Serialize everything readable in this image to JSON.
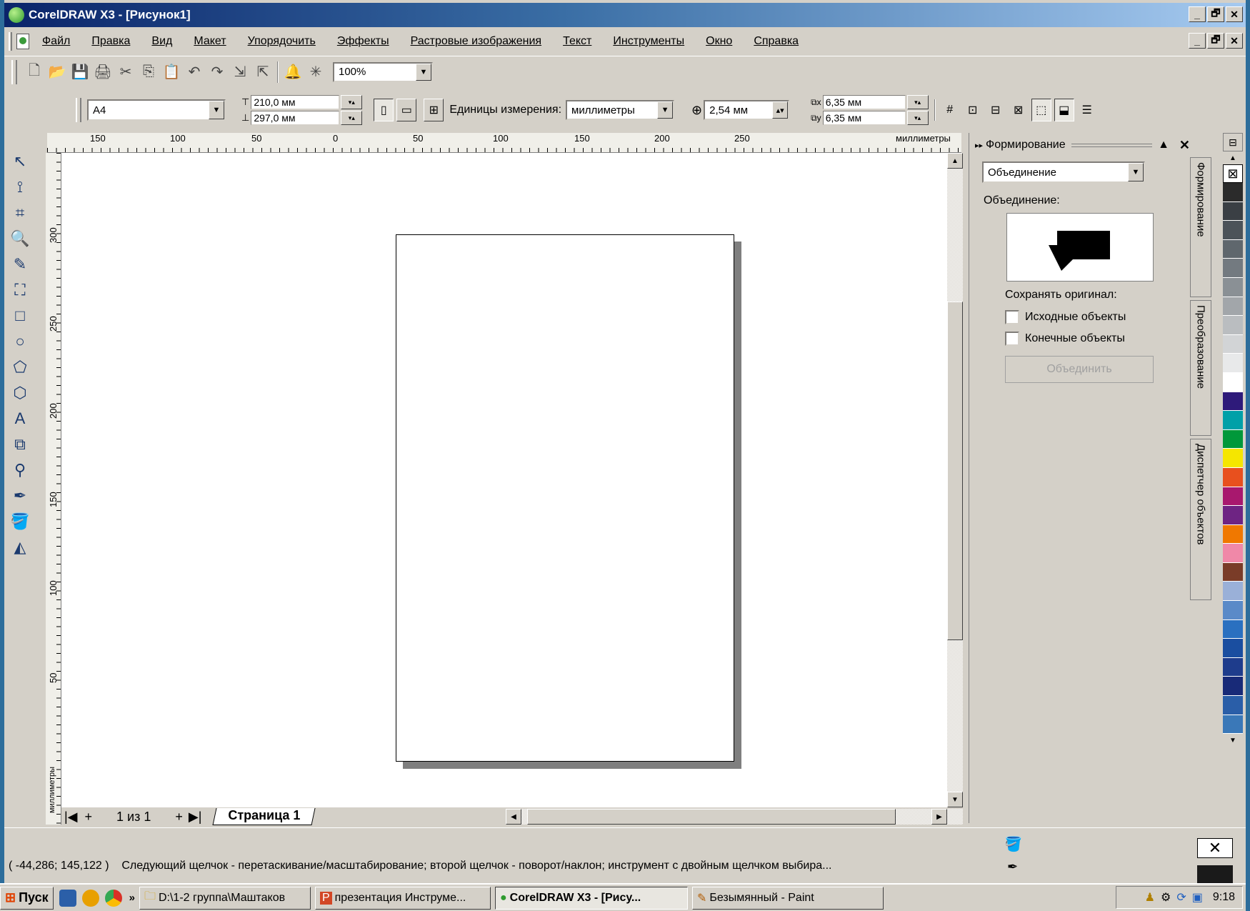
{
  "window": {
    "title": "CorelDRAW X3 - [Рисунок1]",
    "minimize": "_",
    "maximize": "🗗",
    "close": "✕"
  },
  "menu": [
    "Файл",
    "Правка",
    "Вид",
    "Макет",
    "Упорядочить",
    "Эффекты",
    "Растровые изображения",
    "Текст",
    "Инструменты",
    "Окно",
    "Справка"
  ],
  "toolbar": {
    "zoom": "100%"
  },
  "property_bar": {
    "paper": "A4",
    "width": "210,0 мм",
    "height": "297,0 мм",
    "units_label": "Единицы измерения:",
    "units": "миллиметры",
    "nudge": "2,54 мм",
    "dup_x": "6,35 мм",
    "dup_y": "6,35 мм"
  },
  "ruler": {
    "top_labels": [
      "150",
      "100",
      "50",
      "0",
      "50",
      "100",
      "150",
      "200",
      "250"
    ],
    "unit": "миллиметры",
    "left_labels": [
      "300",
      "250",
      "200",
      "150",
      "100",
      "50"
    ],
    "left_unit": "миллиметры"
  },
  "page_nav": {
    "count": "1 из 1",
    "tab": "Страница 1"
  },
  "docker": {
    "title": "Формирование",
    "mode": "Объединение",
    "section": "Объединение:",
    "keep_label": "Сохранять оригинал:",
    "opt1": "Исходные объекты",
    "opt2": "Конечные объекты",
    "apply": "Объединить",
    "tabs": [
      "Формирование",
      "Преобразование",
      "Диспетчер объектов"
    ]
  },
  "palette": [
    "#2b2b2b",
    "#3a3f44",
    "#4c5359",
    "#5f676d",
    "#737a80",
    "#8a9095",
    "#a2a6aa",
    "#babdc0",
    "#d2d4d6",
    "#e8e9ea",
    "#ffffff",
    "#2e1a7a",
    "#00a0a8",
    "#00983a",
    "#f5e600",
    "#e8501e",
    "#a8186e",
    "#6e2483",
    "#f07800",
    "#f088a8",
    "#7a3c28",
    "#9ab0d8",
    "#5a8ac8",
    "#2a70c0",
    "#1a4ea0",
    "#1e3c8c",
    "#182a78",
    "#2a5ea8",
    "#3a78b8"
  ],
  "status": {
    "coords": "( -44,286; 145,122 )",
    "message": "Следующий щелчок - перетаскивание/масштабирование; второй щелчок - поворот/наклон; инструмент с двойным щелчком выбира..."
  },
  "taskbar": {
    "start": "Пуск",
    "tasks": [
      "D:\\1-2 группа\\Маштаков",
      "презентация Инструме...",
      "CorelDRAW X3 - [Рису...",
      "Безымянный - Paint"
    ],
    "clock": "9:18"
  }
}
